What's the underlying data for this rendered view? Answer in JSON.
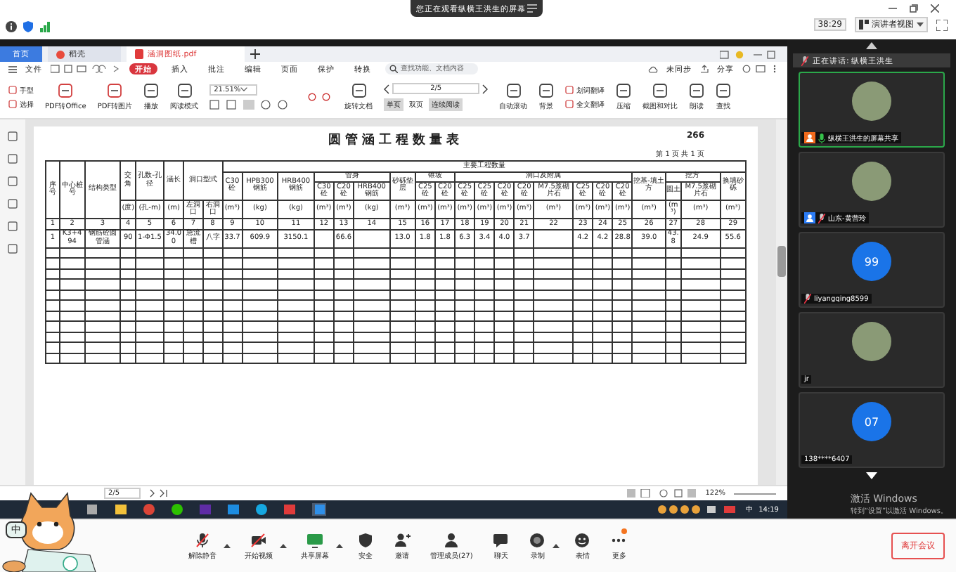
{
  "banner": {
    "text": "您正在观看纵横王洪生的屏幕"
  },
  "meeting_top": {
    "timer": "38:29",
    "view_button": "演讲者视图"
  },
  "wps_tabs": [
    {
      "label": "首页",
      "kind": "home",
      "selected": false
    },
    {
      "label": "稻壳",
      "kind": "app",
      "selected": false
    },
    {
      "label": "涵洞图纸.pdf",
      "kind": "doc",
      "selected": true
    }
  ],
  "menu": {
    "file": "文件",
    "items": [
      {
        "label": "开始",
        "selected": true
      },
      {
        "label": "插入",
        "selected": false
      },
      {
        "label": "批注",
        "selected": false
      },
      {
        "label": "编辑",
        "selected": false
      },
      {
        "label": "页面",
        "selected": false
      },
      {
        "label": "保护",
        "selected": false
      },
      {
        "label": "转换",
        "selected": false
      }
    ],
    "search_placeholder": "查找功能、文档内容",
    "sync": "未同步",
    "share": "分享"
  },
  "tools": [
    {
      "kind": "stack",
      "items": [
        "手型",
        "选择"
      ]
    },
    {
      "kind": "big",
      "label": "PDF转Office"
    },
    {
      "kind": "big",
      "label": "PDF转图片"
    },
    {
      "kind": "big",
      "label": "播放"
    },
    {
      "kind": "big",
      "label": "阅读模式"
    },
    {
      "kind": "zoom",
      "value": "21.51%"
    },
    {
      "kind": "big",
      "label": "旋转文档"
    },
    {
      "kind": "pager",
      "value": "2/5",
      "modes": [
        {
          "label": "单页",
          "selected": true
        },
        {
          "label": "双页",
          "selected": false
        },
        {
          "label": "连续阅读",
          "selected": true
        }
      ]
    },
    {
      "kind": "big",
      "label": "自动滚动"
    },
    {
      "kind": "big",
      "label": "背景"
    },
    {
      "kind": "stack",
      "items": [
        "划词翻译",
        "全文翻译"
      ]
    },
    {
      "kind": "big",
      "label": "压缩"
    },
    {
      "kind": "big",
      "label": "截图和对比"
    },
    {
      "kind": "big",
      "label": "朗读"
    },
    {
      "kind": "big",
      "label": "查找"
    }
  ],
  "document": {
    "title": "圆管涵工程数量表",
    "page_number": "266",
    "page_info": "第 1 页 共 1 页",
    "left_heads": [
      "序号",
      "中心桩号",
      "结构类型"
    ],
    "mid_heads": [
      "交角",
      "孔数-孔径",
      "涵长"
    ],
    "portal_head": "洞口型式",
    "main_head": "主要工程数量",
    "groups": [
      {
        "label": "C30砼"
      },
      {
        "label": "HPB300钢筋"
      },
      {
        "label": "HRB400钢筋"
      },
      {
        "label": "管身",
        "subs": [
          "C30砼",
          "C20砼",
          "HRB400钢筋"
        ]
      },
      {
        "label": "砂砾垫层"
      },
      {
        "label": "锥坡",
        "subs": [
          "C25砼",
          "C20砼"
        ]
      },
      {
        "label": "洞口及附属",
        "subs": [
          "C25砼",
          "C25砼",
          "C20砼",
          "C20砼",
          "M7.5浆砌片石",
          "C25砼",
          "C20砼",
          "C20砼"
        ]
      },
      {
        "label": "挖基-填土方"
      },
      {
        "label": "挖方",
        "subs": [
          "圆土",
          "M7.5浆砌片石"
        ]
      },
      {
        "label": "换填砂砾"
      }
    ],
    "units": [
      "(度)",
      "(孔-m)",
      "(m)",
      "左洞口",
      "右洞口",
      "(m³)",
      "(kg)",
      "(kg)",
      "(m³)",
      "(m³)",
      "(kg)",
      "(m³)",
      "(m³)",
      "(m³)",
      "(m³)",
      "(m³)",
      "(m³)",
      "(m³)",
      "(m³)",
      "(m³)",
      "(m³)",
      "(m³)",
      "(m³)",
      "(m³)",
      "(m³)",
      "(m³)"
    ],
    "numbers": [
      "1",
      "2",
      "3",
      "4",
      "5",
      "6",
      "7",
      "8",
      "9",
      "10",
      "11",
      "12",
      "13",
      "14",
      "15",
      "16",
      "17",
      "18",
      "19",
      "20",
      "21",
      "22",
      "23",
      "24",
      "25",
      "26",
      "27",
      "28",
      "29"
    ],
    "rows": [
      [
        "1",
        "K3+494",
        "钢筋砼圆管涵",
        "90",
        "1-Φ1.5",
        "34.00",
        "急流槽",
        "八字",
        "33.7",
        "609.9",
        "3150.1",
        "",
        "66.6",
        "",
        "13.0",
        "1.8",
        "1.8",
        "6.3",
        "3.4",
        "4.0",
        "3.7",
        "",
        "4.2",
        "4.2",
        "28.8",
        "39.0",
        "43.8",
        "24.9",
        "55.6"
      ]
    ]
  },
  "wps_status": {
    "page": "2/5",
    "zoom": "122%"
  },
  "taskbar": {
    "ime": "中",
    "time": "14:19"
  },
  "speaking": "正在讲话: 纵横王洪生",
  "participants": [
    {
      "name": "纵横王洪生的屏幕共享",
      "kind": "photo",
      "selected": true,
      "color": "#f26b1d",
      "muted": false
    },
    {
      "name": "山东-黄营玲",
      "kind": "photo",
      "selected": false,
      "color": "#2b7cf6",
      "muted": true
    },
    {
      "name": "liyangqing8599",
      "kind": "initials",
      "initials": "99",
      "selected": false,
      "muted": true
    },
    {
      "name": "jr",
      "kind": "photo",
      "selected": false
    },
    {
      "name": "138****6407",
      "kind": "initials",
      "initials": "07",
      "selected": false
    }
  ],
  "activation": {
    "title": "激活 Windows",
    "hint": "转到“设置”以激活 Windows。"
  },
  "meeting_bar": [
    {
      "kind": "mic",
      "label": "解除静音",
      "caret": true,
      "dot": false
    },
    {
      "kind": "video",
      "label": "开始视频",
      "caret": true,
      "dot": false
    },
    {
      "kind": "share",
      "label": "共享屏幕",
      "caret": true,
      "dot": false
    },
    {
      "kind": "security",
      "label": "安全",
      "caret": false,
      "dot": false
    },
    {
      "kind": "invite",
      "label": "邀请",
      "caret": false,
      "dot": false
    },
    {
      "kind": "members",
      "label": "管理成员(27)",
      "caret": false,
      "dot": false
    },
    {
      "kind": "chat",
      "label": "聊天",
      "caret": false,
      "dot": false
    },
    {
      "kind": "record",
      "label": "录制",
      "caret": true,
      "dot": false
    },
    {
      "kind": "emoji",
      "label": "表情",
      "caret": false,
      "dot": false
    },
    {
      "kind": "more",
      "label": "更多",
      "caret": false,
      "dot": true
    }
  ],
  "leave_button": "离开会议",
  "sticker": {
    "badge": "中"
  }
}
